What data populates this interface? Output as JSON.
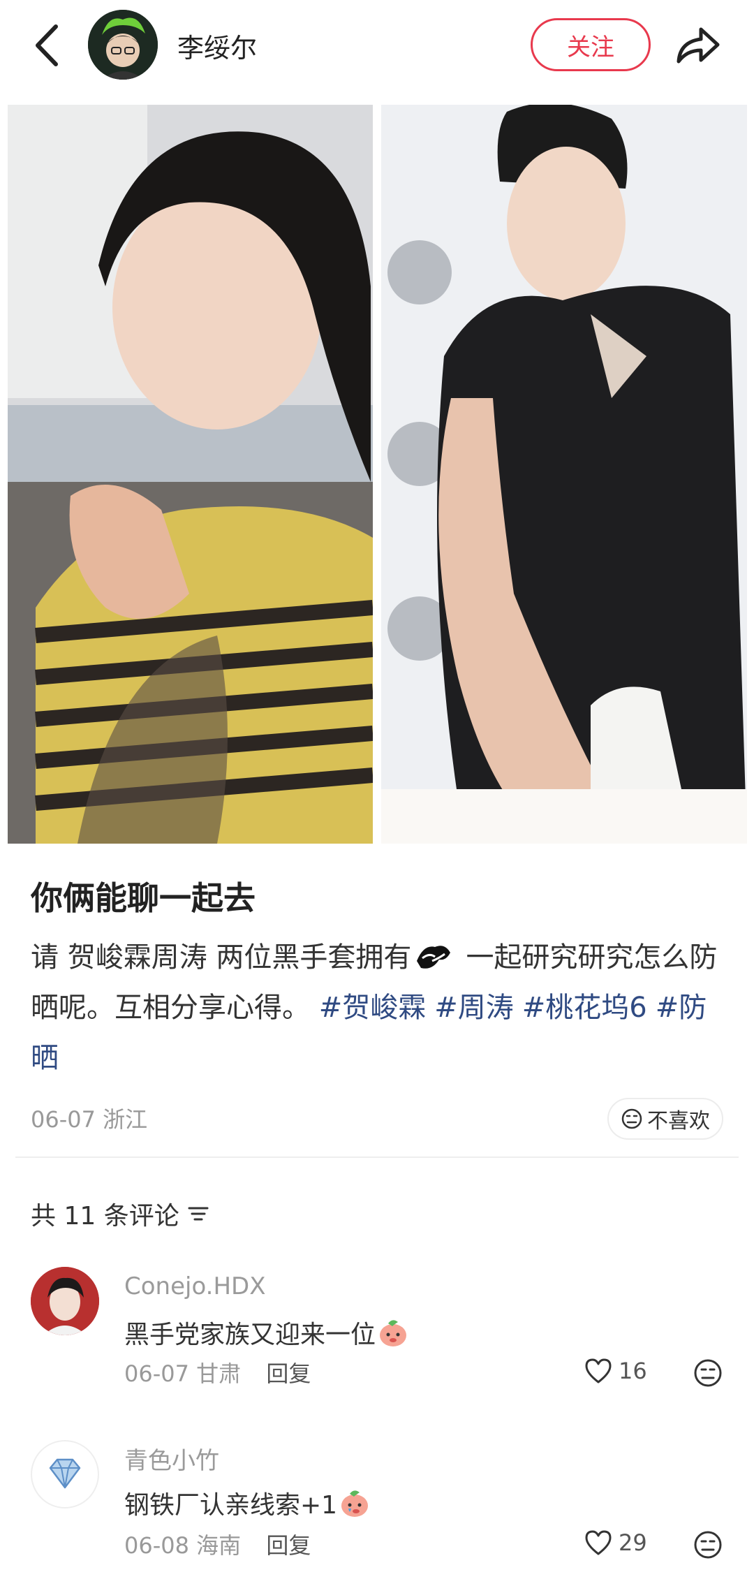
{
  "header": {
    "author_name": "李绥尔",
    "follow_label": "关注"
  },
  "post": {
    "title": "你俩能聊一起去",
    "body_part1": "请 贺峻霖周涛 两位黑手套拥有",
    "body_part2": "一起研究研究怎么防晒呢。互相分享心得。",
    "tags": [
      "#贺峻霖",
      "#周涛",
      "#桃花坞6",
      "#防晒"
    ],
    "date": "06-07",
    "location": "浙江",
    "dislike_label": "不喜欢"
  },
  "comments_header": {
    "label": "共 11 条评论"
  },
  "comments": [
    {
      "user": "Conejo.HDX",
      "text": "黑手党家族又迎来一位",
      "date": "06-07",
      "location": "甘肃",
      "reply_label": "回复",
      "likes": "16"
    },
    {
      "user": "青色小竹",
      "text": "钢铁厂认亲线索+1",
      "date": "06-08",
      "location": "海南",
      "reply_label": "回复",
      "likes": "29"
    }
  ],
  "colors": {
    "accent": "#e8394d",
    "tag": "#2f4a82",
    "muted": "#999999"
  },
  "icons": [
    "back-icon",
    "share-icon",
    "dislike-face-icon",
    "sort-icon",
    "heart-icon",
    "more-face-icon",
    "diamond-icon",
    "peach-emoji"
  ]
}
